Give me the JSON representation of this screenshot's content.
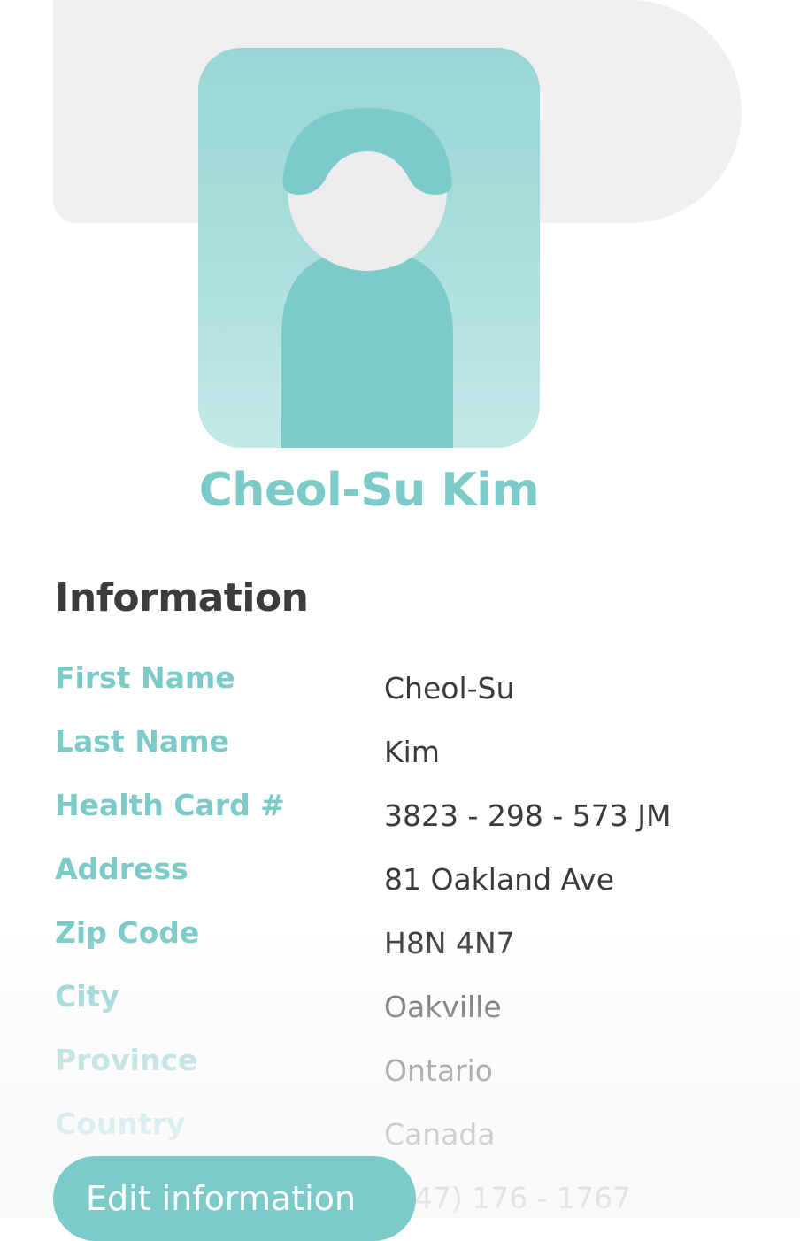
{
  "profile": {
    "name": "Cheol-Su Kim",
    "avatar_icon": "user-silhouette-icon"
  },
  "info": {
    "title": "Information",
    "rows": [
      {
        "label": "First Name",
        "value": "Cheol-Su"
      },
      {
        "label": "Last Name",
        "value": "Kim"
      },
      {
        "label": "Health Card #",
        "value": "3823 - 298 - 573 JM"
      },
      {
        "label": "Address",
        "value": "81 Oakland Ave"
      },
      {
        "label": "Zip Code",
        "value": "H8N 4N7"
      },
      {
        "label": "City",
        "value": "Oakville"
      },
      {
        "label": "Province",
        "value": "Ontario"
      },
      {
        "label": "Country",
        "value": "Canada"
      },
      {
        "label": "",
        "value": "(647) 176 - 1767"
      }
    ]
  },
  "actions": {
    "edit_label": "Edit information"
  },
  "colors": {
    "accent": "#7ccbc9",
    "avatar_bg": "#a9dedc",
    "header_bg": "#efefef",
    "heading": "#3c3c3c",
    "text": "#3a3a3a"
  }
}
